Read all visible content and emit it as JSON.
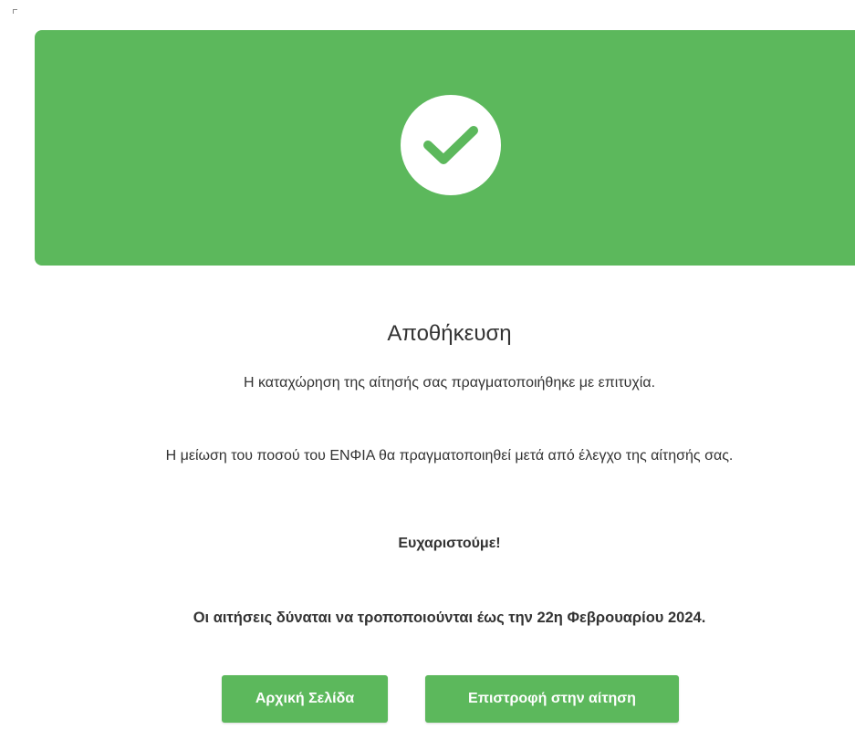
{
  "colors": {
    "success_green": "#5cb85c",
    "text": "#333333",
    "white": "#ffffff"
  },
  "banner": {
    "icon": "check-circle-icon"
  },
  "content": {
    "title": "Αποθήκευση",
    "message_saved": "Η καταχώρηση της αίτησής σας πραγματοποιήθηκε με επιτυχία.",
    "message_reduction": "Η μείωση του ποσού του ΕΝΦΙΑ θα πραγματοποιηθεί μετά από έλεγχο της αίτησής σας.",
    "thanks": "Ευχαριστούμε!",
    "deadline": "Οι αιτήσεις δύναται να τροποποιούνται έως την 22η Φεβρουαρίου 2024."
  },
  "actions": {
    "home_label": "Αρχική Σελίδα",
    "back_label": "Επιστροφή στην αίτηση"
  }
}
